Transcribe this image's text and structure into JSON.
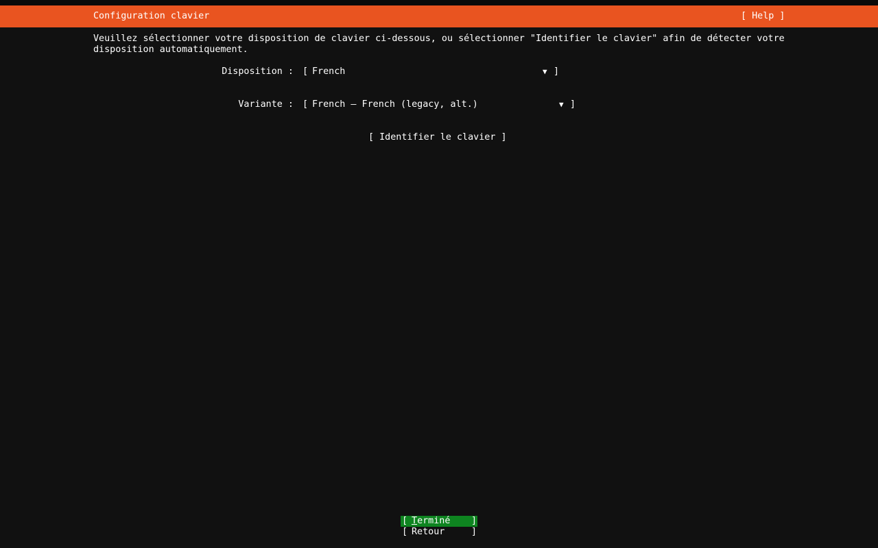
{
  "header": {
    "title": "Configuration clavier",
    "help_label": "[ Help ]"
  },
  "description": "Veuillez sélectionner votre disposition de clavier ci-dessous, ou sélectionner \"Identifier le clavier\" afin de détecter votre disposition automatiquement.",
  "form": {
    "layout": {
      "label": "Disposition :",
      "value": "French",
      "arrow": "▼"
    },
    "variant": {
      "label": "Variante :",
      "value": "French – French (legacy, alt.)",
      "arrow": "▼"
    },
    "bracket_open": "[",
    "bracket_close": "]",
    "identify_label": "[ Identifier le clavier ]"
  },
  "actions": {
    "done_first": "T",
    "done_rest": "erminé",
    "back_label": "Retour"
  },
  "colors": {
    "header_bg": "#e95420",
    "focused_button_bg": "#0e8420",
    "background": "#111111"
  }
}
